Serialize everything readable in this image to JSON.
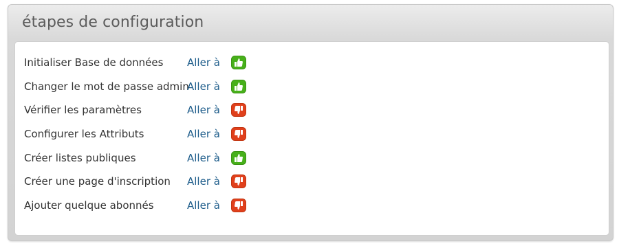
{
  "panel": {
    "title": "étapes de configuration"
  },
  "colors": {
    "ok": "#47b01a",
    "todo": "#e0401c",
    "link": "#1d5c8a"
  },
  "steps": [
    {
      "label": "Initialiser Base de données",
      "link": "Aller à",
      "status": "done",
      "icon": "thumbs-up-icon"
    },
    {
      "label": "Changer le mot de passe admin",
      "link": "Aller à",
      "status": "done",
      "icon": "thumbs-up-icon"
    },
    {
      "label": "Vérifier les paramètres",
      "link": "Aller à",
      "status": "pending",
      "icon": "thumbs-down-icon"
    },
    {
      "label": "Configurer les Attributs",
      "link": "Aller à",
      "status": "pending",
      "icon": "thumbs-down-icon"
    },
    {
      "label": "Créer listes publiques",
      "link": "Aller à",
      "status": "done",
      "icon": "thumbs-up-icon"
    },
    {
      "label": "Créer une page d'inscription",
      "link": "Aller à",
      "status": "pending",
      "icon": "thumbs-down-icon"
    },
    {
      "label": "Ajouter quelque abonnés",
      "link": "Aller à",
      "status": "pending",
      "icon": "thumbs-down-icon"
    }
  ]
}
